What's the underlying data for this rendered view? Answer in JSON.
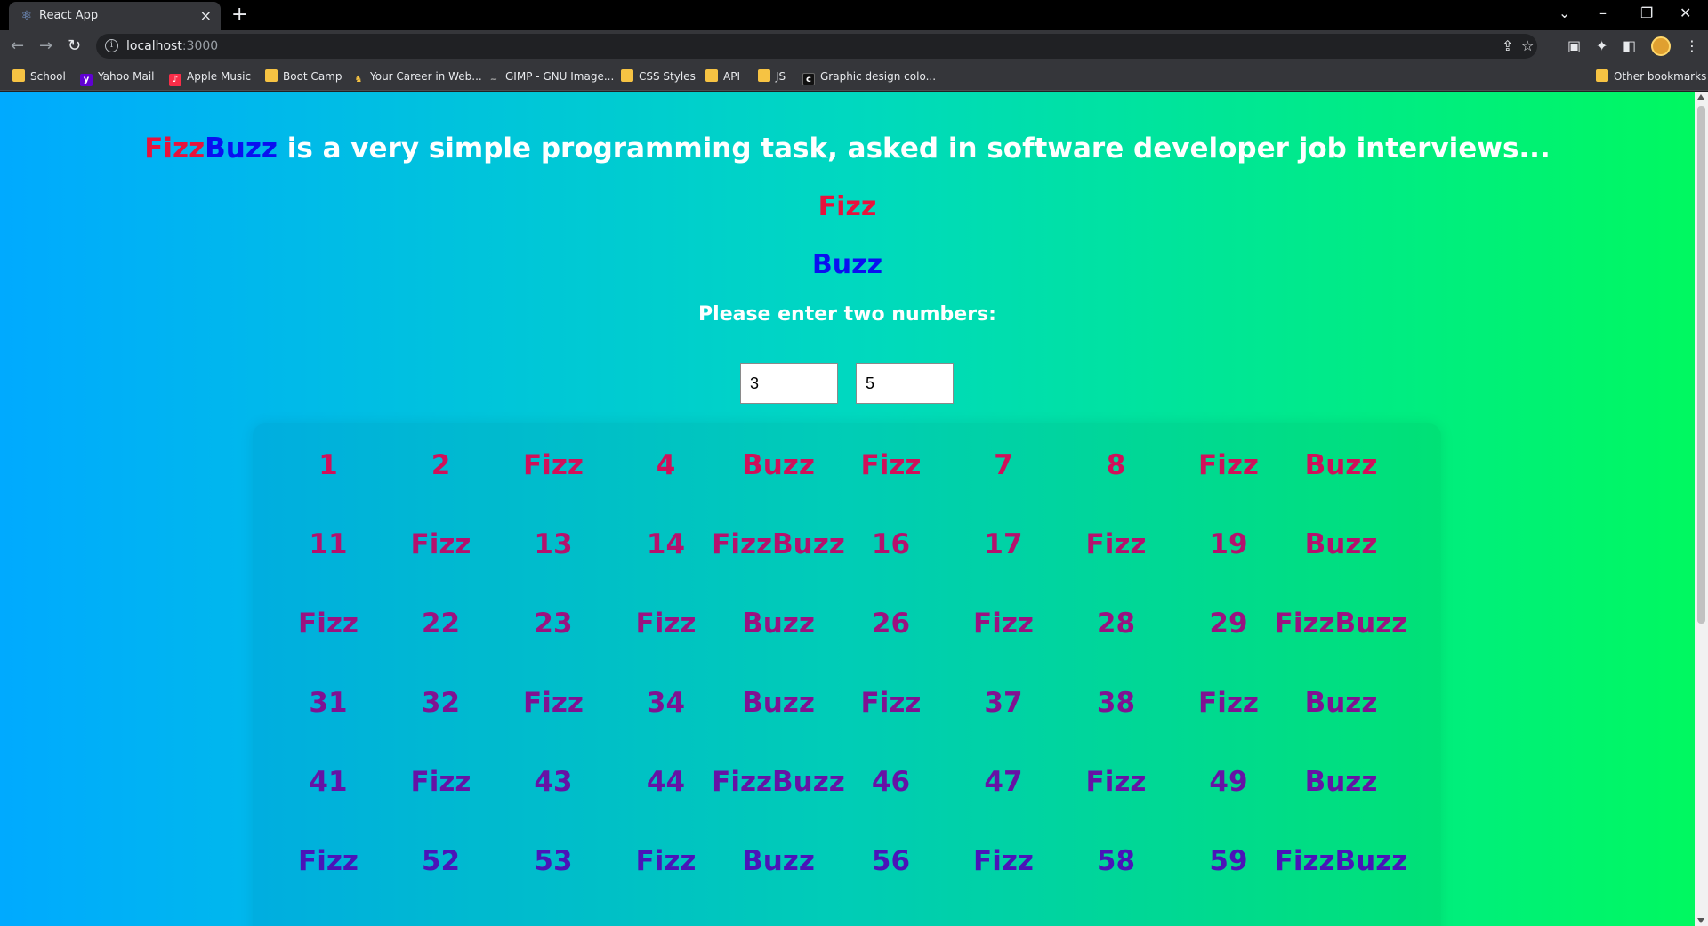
{
  "browser": {
    "tab_title": "React App",
    "url_host": "localhost",
    "url_port": ":3000",
    "bookmarks": [
      {
        "label": "School",
        "icon": "folder-icon"
      },
      {
        "label": "Yahoo Mail",
        "icon": "yahoo-icon"
      },
      {
        "label": "Apple Music",
        "icon": "apple-music-icon"
      },
      {
        "label": "Boot Camp",
        "icon": "folder-icon"
      },
      {
        "label": "Your Career in Web...",
        "icon": "career-icon"
      },
      {
        "label": "GIMP - GNU Image...",
        "icon": "gimp-icon"
      },
      {
        "label": "CSS Styles",
        "icon": "folder-icon"
      },
      {
        "label": "API",
        "icon": "folder-icon"
      },
      {
        "label": "JS",
        "icon": "folder-icon"
      },
      {
        "label": "Graphic design colo...",
        "icon": "cc-icon"
      }
    ],
    "other_bookmarks": "Other bookmarks"
  },
  "page": {
    "headline_fizz": "Fizz",
    "headline_buzz": "Buzz",
    "headline_rest": " is a very simple programming task, asked in software developer job interviews...",
    "fizz_label": "Fizz",
    "buzz_label": "Buzz",
    "prompt": "Please enter two numbers:",
    "input_a": "3",
    "input_b": "5",
    "colors": {
      "fizz": "#e8123c",
      "buzz": "#0a10f0",
      "grid_top": "#d0105a",
      "grid_bottom": "#4b14b8"
    },
    "results": [
      "1",
      "2",
      "Fizz",
      "4",
      "Buzz",
      "Fizz",
      "7",
      "8",
      "Fizz",
      "Buzz",
      "11",
      "Fizz",
      "13",
      "14",
      "FizzBuzz",
      "16",
      "17",
      "Fizz",
      "19",
      "Buzz",
      "Fizz",
      "22",
      "23",
      "Fizz",
      "Buzz",
      "26",
      "Fizz",
      "28",
      "29",
      "FizzBuzz",
      "31",
      "32",
      "Fizz",
      "34",
      "Buzz",
      "Fizz",
      "37",
      "38",
      "Fizz",
      "Buzz",
      "41",
      "Fizz",
      "43",
      "44",
      "FizzBuzz",
      "46",
      "47",
      "Fizz",
      "49",
      "Buzz",
      "Fizz",
      "52",
      "53",
      "Fizz",
      "Buzz",
      "56",
      "Fizz",
      "58",
      "59",
      "FizzBuzz"
    ]
  }
}
